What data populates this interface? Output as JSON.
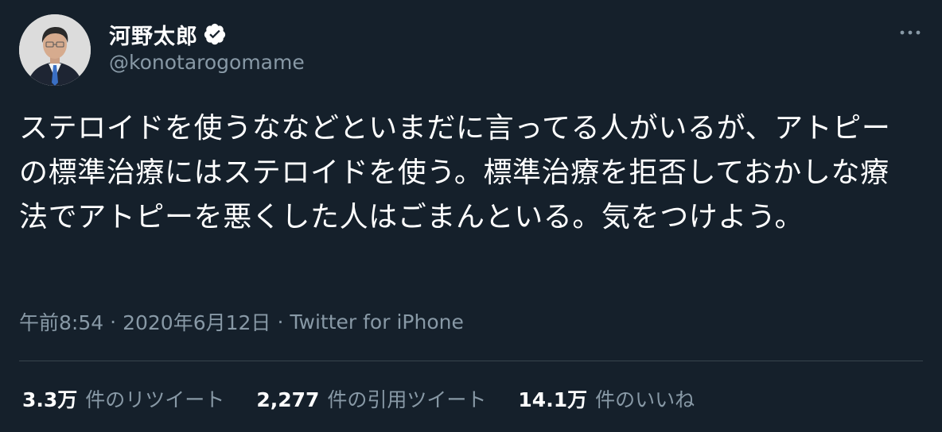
{
  "author": {
    "display_name": "河野太郎",
    "handle": "@konotarogomame",
    "verified": true
  },
  "tweet": {
    "text": "ステロイドを使うななどといまだに言ってる人がいるが、アトピーの標準治療にはステロイドを使う。標準治療を拒否しておかしな療法でアトピーを悪くした人はごまんといる。気をつけよう。",
    "time": "午前8:54",
    "date": "2020年6月12日",
    "source": "Twitter for iPhone",
    "separator": "·"
  },
  "stats": {
    "retweets": {
      "value": "3.3万",
      "label": "件のリツイート"
    },
    "quotes": {
      "value": "2,277",
      "label": "件の引用ツイート"
    },
    "likes": {
      "value": "14.1万",
      "label": "件のいいね"
    }
  },
  "colors": {
    "background": "#15202b",
    "primary_text": "#ffffff",
    "secondary_text": "#8899a6",
    "divider": "#38444d",
    "verified_badge": "#ffffff"
  },
  "icons": {
    "verified": "verified-badge-icon",
    "more": "more-options-icon"
  }
}
